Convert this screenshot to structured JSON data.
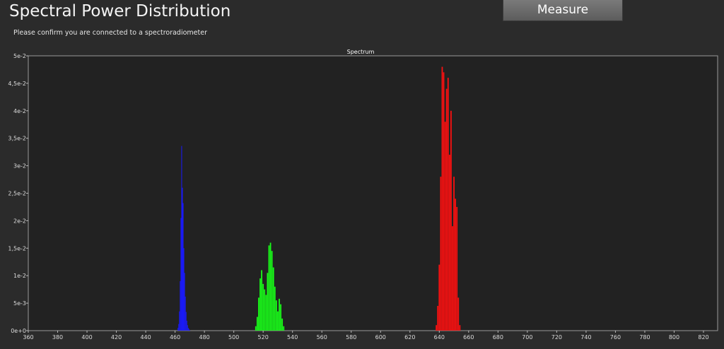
{
  "page": {
    "title": "Spectral Power Distribution",
    "subtitle": "Please confirm you are connected to a spectroradiometer",
    "measure_label": "Measure"
  },
  "colors": {
    "background": "#2b2b2b",
    "plot_background": "#222222",
    "blue_series": "#1a1aff",
    "green_series": "#18ff18",
    "red_series": "#ff1010"
  },
  "chart_data": {
    "type": "bar",
    "title": "Spectrum",
    "xlabel": "",
    "ylabel": "",
    "xlim": [
      360,
      820
    ],
    "ylim": [
      0,
      0.05
    ],
    "grid": false,
    "x_ticks": [
      360,
      380,
      400,
      420,
      440,
      460,
      480,
      500,
      520,
      540,
      560,
      580,
      600,
      620,
      640,
      660,
      680,
      700,
      720,
      740,
      760,
      780,
      800,
      820
    ],
    "x_tick_labels": [
      "360",
      "380",
      "400",
      "420",
      "440",
      "460",
      "480",
      "500",
      "520",
      "540",
      "560",
      "580",
      "600",
      "620",
      "640",
      "660",
      "680",
      "700",
      "720",
      "740",
      "760",
      "780",
      "800",
      "820"
    ],
    "y_ticks": [
      0,
      0.005,
      0.01,
      0.015,
      0.02,
      0.025,
      0.03,
      0.035,
      0.04,
      0.045,
      0.05
    ],
    "y_tick_labels": [
      "0e+0",
      "5e-3",
      "1e-2",
      "1,5e-2",
      "2e-2",
      "2,5e-2",
      "3e-2",
      "3,5e-2",
      "4e-2",
      "4,5e-2",
      "5e-2"
    ],
    "series": [
      {
        "color": "#1a1aff",
        "x": [
          462,
          462.5,
          463,
          463.5,
          464,
          464.5,
          465,
          465.5,
          466,
          466.5,
          467,
          467.5,
          468,
          468.5,
          469,
          469.5,
          470
        ],
        "y": [
          0.0005,
          0.0012,
          0.0035,
          0.009,
          0.0205,
          0.0336,
          0.026,
          0.0232,
          0.015,
          0.0105,
          0.0062,
          0.0034,
          0.0018,
          0.001,
          0.0005,
          0.0003,
          0.0001
        ]
      },
      {
        "color": "#18ff18",
        "x": [
          515,
          516,
          517,
          518,
          519,
          520,
          521,
          522,
          523,
          524,
          525,
          526,
          527,
          528,
          529,
          530,
          531,
          532,
          533,
          534
        ],
        "y": [
          0.0008,
          0.0025,
          0.006,
          0.0095,
          0.011,
          0.0085,
          0.0075,
          0.0065,
          0.0105,
          0.0155,
          0.016,
          0.0145,
          0.0115,
          0.008,
          0.0055,
          0.0035,
          0.0058,
          0.0048,
          0.0022,
          0.0008
        ]
      },
      {
        "color": "#ff1010",
        "x": [
          638,
          639,
          640,
          641,
          642,
          643,
          644,
          645,
          646,
          647,
          648,
          649,
          650,
          651,
          652,
          653,
          654
        ],
        "y": [
          0.001,
          0.0045,
          0.012,
          0.028,
          0.048,
          0.047,
          0.038,
          0.044,
          0.046,
          0.032,
          0.04,
          0.019,
          0.028,
          0.024,
          0.0225,
          0.006,
          0.001
        ]
      }
    ]
  }
}
